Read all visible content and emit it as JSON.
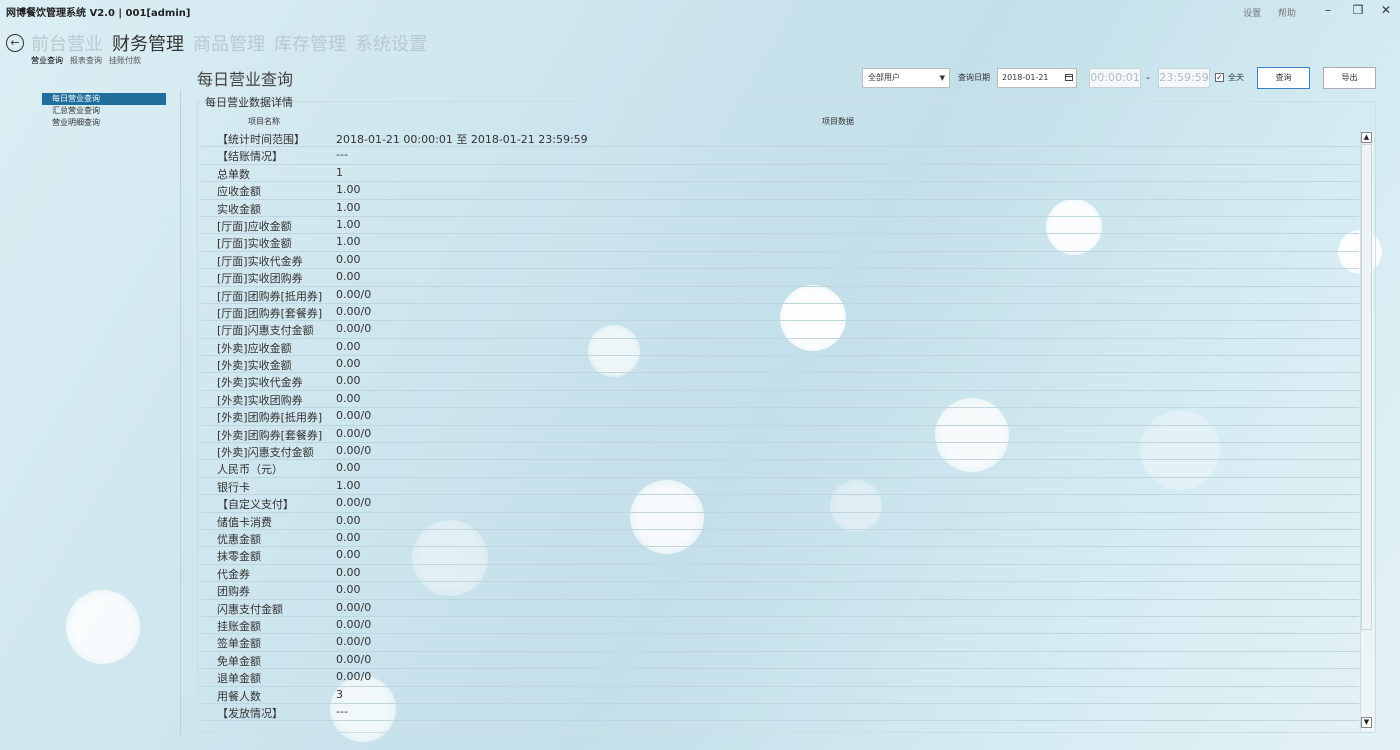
{
  "app": {
    "title": "网博餐饮管理系统 V2.0 | 001[admin]",
    "links": [
      "设置",
      "帮助"
    ],
    "controls": [
      "–",
      "❐",
      "✕"
    ]
  },
  "nav": {
    "back_icon": "←",
    "modules": [
      "前台营业",
      "财务管理",
      "商品管理",
      "库存管理",
      "系统设置"
    ],
    "active_module": "财务管理",
    "subtabs": [
      "营业查询",
      "报表查询",
      "挂账付款"
    ]
  },
  "sidebar": {
    "items": [
      {
        "label": "每日营业查询",
        "active": true
      },
      {
        "label": "汇总营业查询",
        "active": false
      },
      {
        "label": "营业明细查询",
        "active": false
      }
    ]
  },
  "page": {
    "title": "每日营业查询"
  },
  "filters": {
    "user_select": "全部用户",
    "date_label": "查询日期",
    "date_value": "2018-01-21",
    "time_start": "00:00:01",
    "time_sep": "-",
    "time_end": "23:59:59",
    "allday_label": "全天",
    "allday_checked": true,
    "query_button": "查询",
    "export_button": "导出"
  },
  "panel": {
    "title": "每日营业数据详情",
    "col_name": "项目名称",
    "col_value": "项目数据"
  },
  "rows": [
    {
      "name": "【统计时间范围】",
      "value": "2018-01-21 00:00:01 至 2018-01-21 23:59:59"
    },
    {
      "name": "【结账情况】",
      "value": "---"
    },
    {
      "name": "总单数",
      "value": "1"
    },
    {
      "name": "应收金额",
      "value": "1.00"
    },
    {
      "name": "实收金额",
      "value": "1.00"
    },
    {
      "name": "[厅面]应收金额",
      "value": "1.00"
    },
    {
      "name": "[厅面]实收金额",
      "value": "1.00"
    },
    {
      "name": "[厅面]实收代金券",
      "value": "0.00"
    },
    {
      "name": "[厅面]实收团购券",
      "value": "0.00"
    },
    {
      "name": "[厅面]团购券[抵用券]",
      "value": "0.00/0"
    },
    {
      "name": "[厅面]团购券[套餐券]",
      "value": "0.00/0"
    },
    {
      "name": "[厅面]闪惠支付金额",
      "value": "0.00/0"
    },
    {
      "name": "[外卖]应收金额",
      "value": "0.00"
    },
    {
      "name": "[外卖]实收金额",
      "value": "0.00"
    },
    {
      "name": "[外卖]实收代金券",
      "value": "0.00"
    },
    {
      "name": "[外卖]实收团购券",
      "value": "0.00"
    },
    {
      "name": "[外卖]团购券[抵用券]",
      "value": "0.00/0"
    },
    {
      "name": "[外卖]团购券[套餐券]",
      "value": "0.00/0"
    },
    {
      "name": "[外卖]闪惠支付金额",
      "value": "0.00/0"
    },
    {
      "name": "人民币（元）",
      "value": "0.00"
    },
    {
      "name": "银行卡",
      "value": "1.00"
    },
    {
      "name": "【自定义支付】",
      "value": "0.00/0"
    },
    {
      "name": "储值卡消费",
      "value": "0.00"
    },
    {
      "name": "优惠金额",
      "value": "0.00"
    },
    {
      "name": "抹零金额",
      "value": "0.00"
    },
    {
      "name": "代金券",
      "value": "0.00"
    },
    {
      "name": "团购券",
      "value": "0.00"
    },
    {
      "name": "闪惠支付金额",
      "value": "0.00/0"
    },
    {
      "name": "挂账金额",
      "value": "0.00/0"
    },
    {
      "name": "签单金额",
      "value": "0.00/0"
    },
    {
      "name": "免单金额",
      "value": "0.00/0"
    },
    {
      "name": "退单金额",
      "value": "0.00/0"
    },
    {
      "name": "用餐人数",
      "value": "3"
    },
    {
      "name": "【发放情况】",
      "value": "---"
    }
  ],
  "colors": {
    "accent": "#1f6e9c",
    "row_border": "#bfd6de"
  }
}
